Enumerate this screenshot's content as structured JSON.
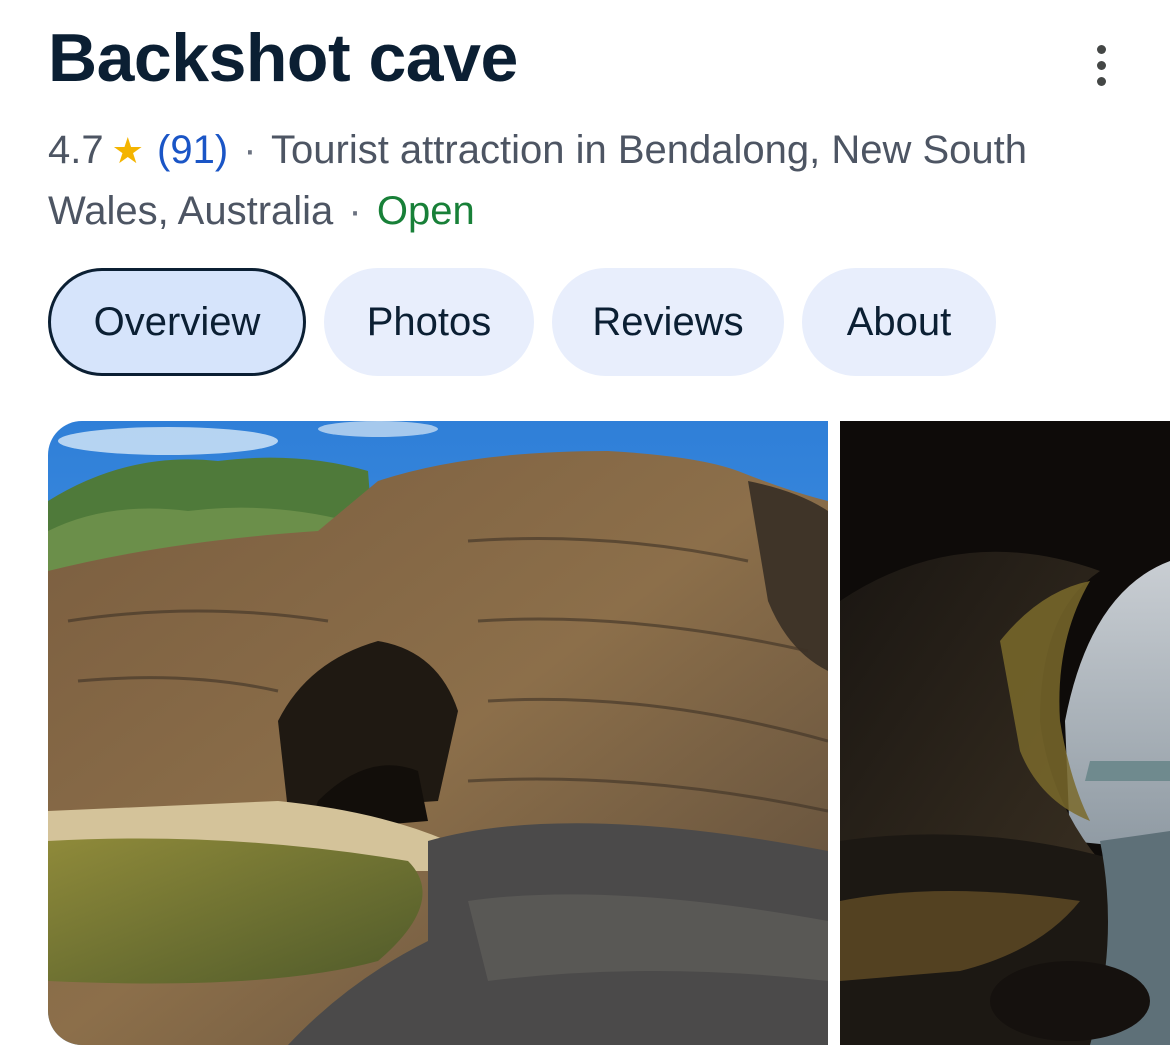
{
  "place": {
    "title": "Backshot cave",
    "rating": "4.7",
    "review_count": "(91)",
    "category": "Tourist attraction in Bendalong, New South Wales, Australia",
    "status": "Open"
  },
  "tabs": [
    {
      "label": "Overview",
      "active": true
    },
    {
      "label": "Photos",
      "active": false
    },
    {
      "label": "Reviews",
      "active": false
    },
    {
      "label": "About",
      "active": false
    }
  ],
  "colors": {
    "title": "#0b1f33",
    "meta": "#4d5563",
    "review_link": "#1a55c6",
    "open_status": "#188038",
    "star": "#f4b400",
    "tab_background": "#e8eefc",
    "tab_active_background": "#d6e4fb"
  },
  "icons": {
    "more": "more-vert-icon",
    "star": "star-icon"
  }
}
